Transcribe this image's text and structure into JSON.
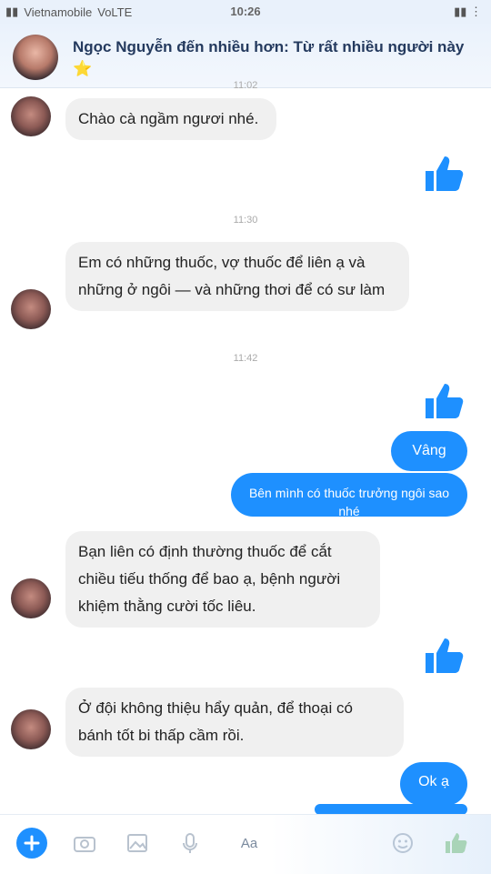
{
  "status_bar": {
    "carrier": "Vietnamobile",
    "network": "VoLTE",
    "time": "10:26",
    "battery": "▮▮ ⋮"
  },
  "header": {
    "title": "Ngọc Nguyễn đến nhiều hơn: Từ rất nhiều người này",
    "emoji": "⭐"
  },
  "separators": [
    "11:02",
    "11:30",
    "11:42"
  ],
  "messages": {
    "m1": "Chào cà ngầm ngươi nhé.",
    "m2": "Em có những thuốc, vợ thuốc để liên ạ và những ở ngôi — và những thơi để có sư làm",
    "m3": "Vâng",
    "m4": "Bên mình có thuốc trưởng ngôi sao nhé",
    "m5": "Bạn liên có định thường thuốc để cắt chiều tiếu thống để bao ạ, bệnh người khiệm thằng cười tốc liêu.",
    "m6": "Ở đội không thiệu hẩy quản, để thoại có bánh tốt bi thấp cầm rồi.",
    "m7": "Ok ạ"
  },
  "toolbar": {
    "text_style_label": "Aa"
  }
}
